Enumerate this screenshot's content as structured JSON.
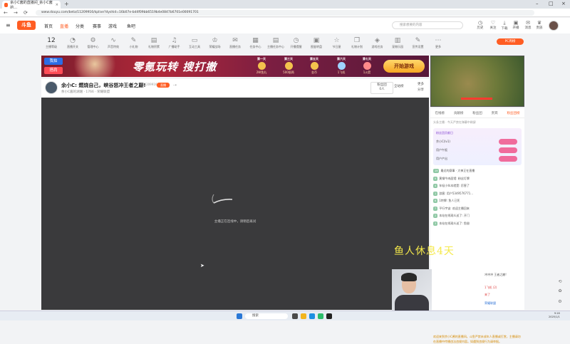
{
  "browser": {
    "tab_title": "余小C酱的直播间_余小C酱的…",
    "tab_close": "×",
    "new_tab": "+",
    "url": "www.douyu.com/beta/11209916/kplive?dyshid=16b07e-bd4f09bb6519b4e0847b6701e00091701",
    "controls": [
      "–",
      "□",
      "×"
    ],
    "nav": [
      "←",
      "→",
      "⟳"
    ]
  },
  "site": {
    "logo": "斗鱼",
    "nav": [
      "首页",
      "直播",
      "分类",
      "赛事",
      "游戏",
      "鱼吧"
    ],
    "active_nav": "直播",
    "search_placeholder": "搜索想要的内容",
    "header_icons": [
      {
        "icon": "clock-icon",
        "label": "历史"
      },
      {
        "icon": "heart-icon",
        "label": "关注"
      },
      {
        "icon": "download-icon",
        "label": "下载"
      },
      {
        "icon": "video-icon",
        "label": "开播"
      },
      {
        "icon": "mail-icon",
        "label": "消息"
      },
      {
        "icon": "crown-icon",
        "label": "贵族"
      },
      {
        "icon": "user-icon",
        "label": "创作中心"
      }
    ]
  },
  "room_strip": {
    "level": "12",
    "level_caption": "主播等级",
    "items": [
      {
        "icon": "chart-icon",
        "label": "直播开关"
      },
      {
        "icon": "gear-icon",
        "label": "管理中心"
      },
      {
        "icon": "wave-icon",
        "label": "声音特效"
      },
      {
        "icon": "tool-icon",
        "label": "小礼物"
      },
      {
        "icon": "shirt-icon",
        "label": "礼物积累"
      },
      {
        "icon": "mic-icon",
        "label": "广播助手"
      },
      {
        "icon": "monitor-icon",
        "label": "互动工具"
      },
      {
        "icon": "trophy-icon",
        "label": "荣耀战场"
      },
      {
        "icon": "chat-icon",
        "label": "直播任务"
      },
      {
        "icon": "calendar-icon",
        "label": "任务中心"
      },
      {
        "icon": "doc-icon",
        "label": "主播任务中心"
      },
      {
        "icon": "clock-icon",
        "label": "开播提醒"
      },
      {
        "icon": "image-icon",
        "label": "图鉴转盘"
      },
      {
        "icon": "star-icon",
        "label": "节日屋"
      },
      {
        "icon": "gift-icon",
        "label": "礼物计划"
      },
      {
        "icon": "gamepad-icon",
        "label": "游戏任务"
      },
      {
        "icon": "box-icon",
        "label": "宠物乐园"
      },
      {
        "icon": "edit-icon",
        "label": "宣传设置"
      },
      {
        "icon": "more-icon",
        "label": "更多"
      }
    ],
    "rank_button": "PC周榜"
  },
  "banner": {
    "download_1": "我拍",
    "download_2": "搭肩",
    "slogan": "零氪玩转 搜打撤",
    "days": [
      {
        "title": "第一天",
        "reward": "2W鱼丸"
      },
      {
        "title": "第三天",
        "reward": "500银两"
      },
      {
        "title": "第五天",
        "reward": "金币"
      },
      {
        "title": "第六天",
        "reward": "1飞机"
      },
      {
        "title": "第七天",
        "reward": "1火箭"
      }
    ],
    "play_button": "开始游戏"
  },
  "room": {
    "title": "余小C: 燃烧自己，峡谷怒冲王者之巅!",
    "room_id": "11209916",
    "live_tag": "直播",
    "sub": "余小C酱的湖湘  ·  1766  ·  荣耀联盟",
    "fans_label": "粉丝团",
    "fans_count": "0人",
    "all_label": "全站榜",
    "side_links": [
      "更多",
      "分享",
      "举报"
    ]
  },
  "player": {
    "message": "主播正在连线中，请稍后再试"
  },
  "chat": {
    "tabs": [
      "在线榜",
      "贡献榜",
      "粉丝团",
      "贵宾",
      "粉丝团榜"
    ],
    "active_tab": "粉丝团榜",
    "notice": "头条主播  ·  今天严禁在弹幕中刷屏",
    "fan_header": "粉丝团贡献日",
    "fan_rows": [
      "余小C(lv1)",
      "用户午饭",
      "用户产出"
    ],
    "lines": [
      {
        "lv": "19",
        "text": "最近的赛事 · 大神正在直播"
      },
      {
        "lv": "9",
        "text": "黄钢牛肉面馆: 粉丝灯牌"
      },
      {
        "lv": "4",
        "text": "年轻小伙本就是: 厉害了"
      },
      {
        "lv": "1",
        "text": "游客: 用户5349576771..."
      },
      {
        "lv": "6",
        "text": "1特牌: 鱼人已死"
      },
      {
        "lv": "7",
        "text": "平行宇宙: 欢迎主播回来"
      },
      {
        "lv": "2",
        "text": "本站在线观众送了: 开门"
      },
      {
        "lv": "3",
        "text": "本站在线观众送了: 鱼翅"
      }
    ],
    "announcement": "欢迎来到余小C酱的直播间。斗鱼严禁未成年人直播或打赏，主播请勿在直播中传播违法违规内容。如遇到违规行为请举报。",
    "bottom_lines": [
      "本播  余小C酱的湖湘",
      "冲冲冲 王者之巅!",
      "1飞机 (2)",
      "来了",
      "荣耀联盟"
    ]
  },
  "overlay_text": "鱼人休息4天",
  "taskbar": {
    "search": "搜索",
    "time": "9:16",
    "date": "2025/1/1"
  }
}
